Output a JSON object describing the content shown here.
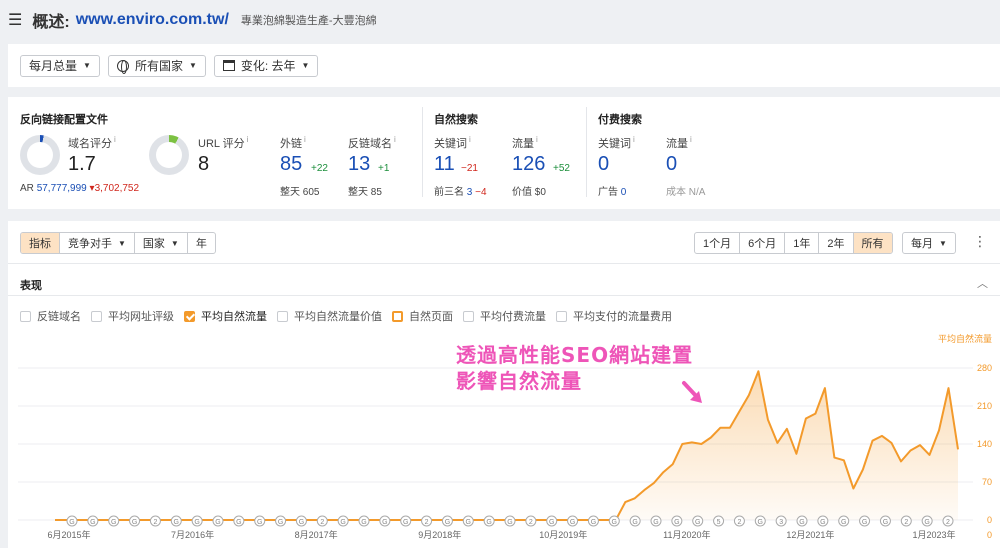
{
  "header": {
    "title_prefix": "概述:",
    "domain": "www.enviro.com.tw/",
    "subtitle": "專業泡綿製造生產-大豐泡綿"
  },
  "filters": {
    "monthly_total": "每月总量",
    "all_countries": "所有国家",
    "change_label": "变化: 去年"
  },
  "backlinks": {
    "section_title": "反向链接配置文件",
    "dr_label": "域名评分",
    "dr_value": "1.7",
    "dr_fill_percent": 3,
    "ar_label": "AR",
    "ar_value": "57,777,999",
    "ar_delta": "3,702,752",
    "ur_label": "URL 评分",
    "ur_value": "8",
    "ur_fill_percent": 8,
    "backlinks_label": "外链",
    "backlinks_value": "85",
    "backlinks_delta": "+22",
    "backlinks_sub_label": "整天",
    "backlinks_sub_value": "605",
    "refdomains_label": "反链域名",
    "refdomains_value": "13",
    "refdomains_delta": "+1",
    "refdomains_sub_label": "整天",
    "refdomains_sub_value": "85"
  },
  "organic": {
    "section_title": "自然搜索",
    "keywords_label": "关键词",
    "keywords_value": "11",
    "keywords_delta": "−21",
    "keywords_sub_label": "前三名",
    "keywords_sub_value": "3",
    "keywords_sub_delta": "−4",
    "traffic_label": "流量",
    "traffic_value": "126",
    "traffic_delta": "+52",
    "traffic_sub_label": "价值",
    "traffic_sub_value": "$0"
  },
  "paid": {
    "section_title": "付费搜索",
    "keywords_label": "关键词",
    "keywords_value": "0",
    "keywords_sub_label": "广告",
    "keywords_sub_value": "0",
    "traffic_label": "流量",
    "traffic_value": "0",
    "traffic_sub_label": "成本",
    "traffic_sub_value": "N/A"
  },
  "chart_toolbar": {
    "tabs": [
      "指标",
      "竞争对手",
      "国家",
      "年"
    ],
    "ranges": [
      "1个月",
      "6个月",
      "1年",
      "2年",
      "所有"
    ],
    "interval": "每月"
  },
  "performance": {
    "title": "表现",
    "legend": [
      "反链域名",
      "平均网址评级",
      "平均自然流量",
      "平均自然流量价值",
      "自然页面",
      "平均付费流量",
      "平均支付的流量费用"
    ]
  },
  "promo": {
    "line1": "透過高性能SEO網站建置",
    "line2": "影響自然流量"
  },
  "colors": {
    "accent": "#f39a2b",
    "brand_blue": "#1a4fb5",
    "promo_pink": "#ee55b8"
  },
  "chart_data": {
    "type": "area",
    "ylabel": "平均自然流量",
    "ylim": [
      0,
      280
    ],
    "y_ticks": [
      0,
      70,
      140,
      210,
      280
    ],
    "x_labels": [
      "6月2015年",
      "7月2016年",
      "8月2017年",
      "9月2018年",
      "10月2019年",
      "11月2020年",
      "12月2021年",
      "1月2023年"
    ],
    "x_label_index": [
      0,
      13,
      26,
      39,
      52,
      65,
      78,
      91
    ],
    "values": [
      0,
      0,
      0,
      0,
      0,
      0,
      0,
      0,
      0,
      0,
      0,
      0,
      0,
      0,
      0,
      0,
      0,
      0,
      0,
      0,
      0,
      0,
      0,
      0,
      0,
      0,
      0,
      0,
      0,
      0,
      0,
      0,
      0,
      0,
      0,
      0,
      0,
      0,
      0,
      0,
      0,
      0,
      0,
      0,
      0,
      0,
      0,
      0,
      0,
      0,
      0,
      0,
      0,
      0,
      0,
      0,
      0,
      0,
      0,
      0,
      33,
      40,
      55,
      68,
      88,
      103,
      140,
      143,
      140,
      152,
      170,
      170,
      200,
      230,
      274,
      185,
      142,
      168,
      122,
      187,
      196,
      243,
      115,
      110,
      58,
      93,
      146,
      155,
      142,
      108,
      128,
      138,
      120,
      165,
      243,
      130
    ],
    "annotation_labels": [
      "G",
      "G",
      "G",
      "G",
      "2",
      "G",
      "G",
      "G",
      "G",
      "G",
      "G",
      "G",
      "2",
      "G",
      "G",
      "G",
      "G",
      "2",
      "G",
      "G",
      "G",
      "G",
      "2",
      "G",
      "G",
      "G",
      "G",
      "G",
      "G",
      "G",
      "G",
      "5",
      "2",
      "G",
      "3",
      "G",
      "G",
      "G",
      "G",
      "G",
      "2",
      "G",
      "2"
    ]
  }
}
